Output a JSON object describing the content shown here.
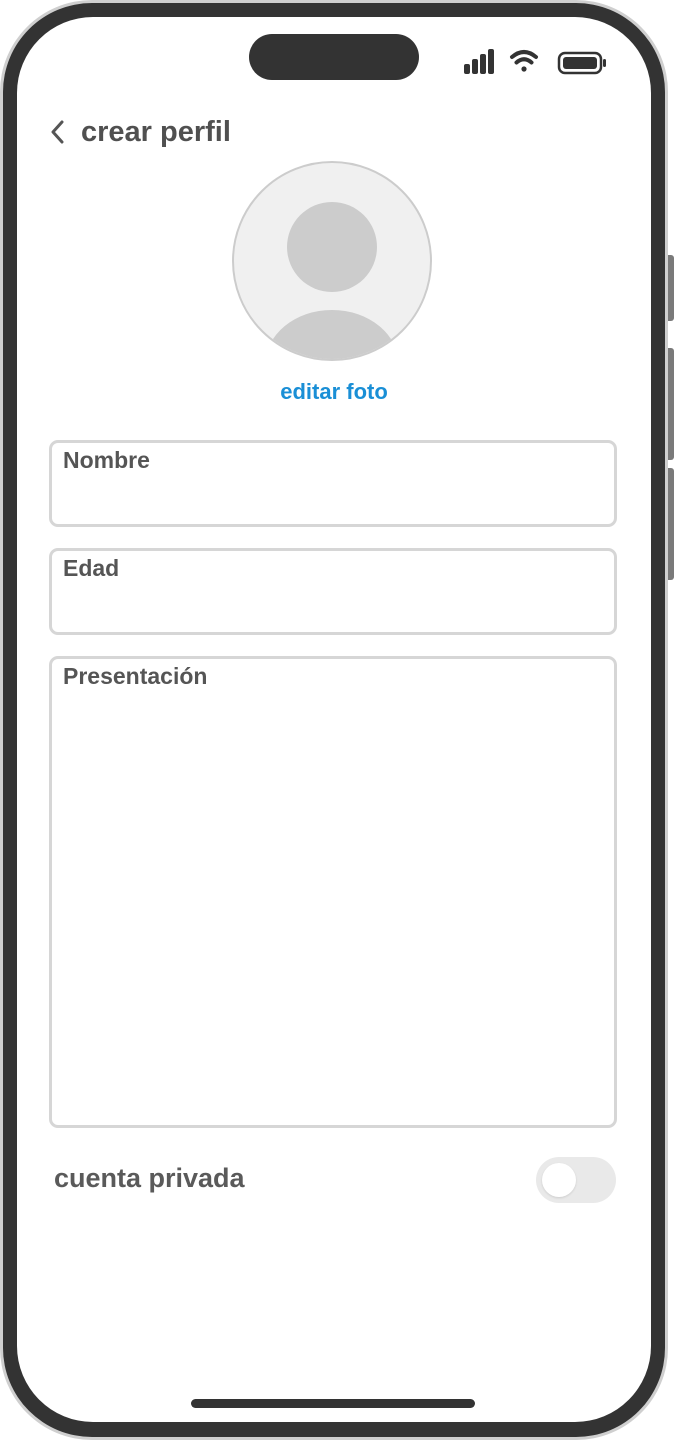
{
  "header": {
    "back_icon": "chevron-left-icon",
    "title": "crear perfil"
  },
  "status_bar": {
    "icons": [
      "cellular-signal-icon",
      "wifi-icon",
      "battery-icon"
    ]
  },
  "profile_photo": {
    "placeholder_icon": "person-silhouette-icon",
    "edit_label": "editar foto",
    "edit_color": "#1a8fd6"
  },
  "form": {
    "name_label": "Nombre",
    "name_value": "",
    "age_label": "Edad",
    "age_value": "",
    "bio_label": "Presentación",
    "bio_value": ""
  },
  "privacy": {
    "label": "cuenta privada",
    "enabled": false
  }
}
